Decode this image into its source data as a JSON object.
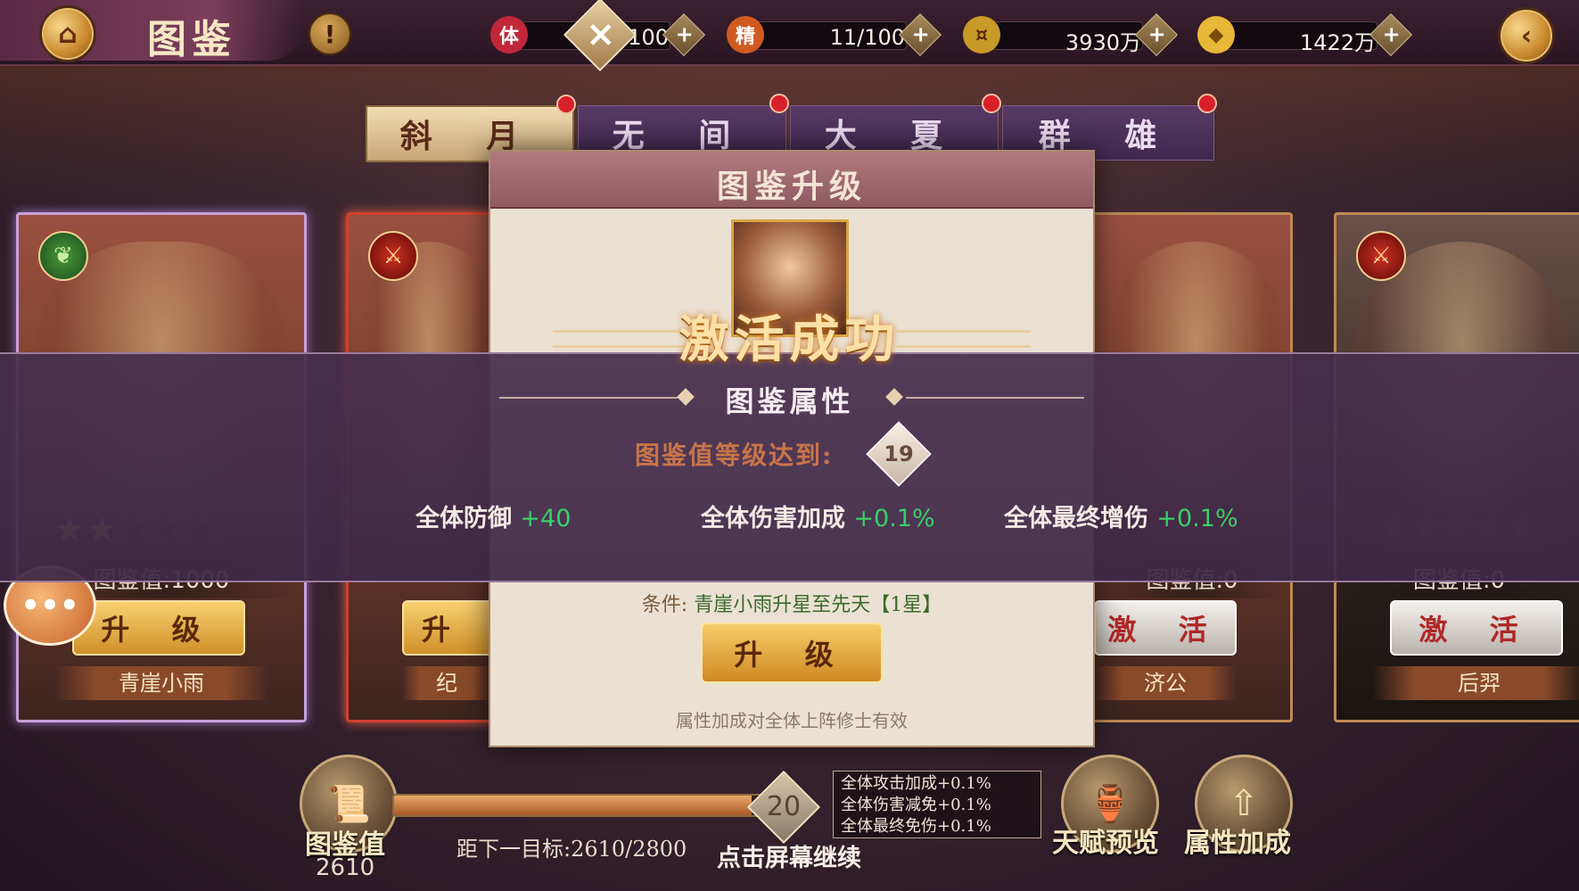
{
  "header": {
    "title": "图鉴",
    "resources": [
      {
        "icon": "stamina-icon",
        "glyph": "体",
        "value": "275/100",
        "color": "#c0283a"
      },
      {
        "icon": "spirit-icon",
        "glyph": "精",
        "value": "11/100",
        "color": "#d05a20"
      },
      {
        "icon": "coin-icon",
        "glyph": "¤",
        "value": "3930万",
        "color": "#c89a2a"
      },
      {
        "icon": "gold-ingot-icon",
        "glyph": "◆",
        "value": "1422万",
        "color": "#e8b838"
      }
    ]
  },
  "tabs": [
    {
      "label": "斜 月",
      "active": true
    },
    {
      "label": "无 间",
      "active": false
    },
    {
      "label": "大 夏",
      "active": false
    },
    {
      "label": "群 雄",
      "active": false
    }
  ],
  "cards": [
    {
      "name": "青崖小雨",
      "value_label": "图鉴值:1000",
      "button": "升 级",
      "stars_on": 2,
      "stars_total": 5
    },
    {
      "name": "纪",
      "button": "升"
    },
    {
      "name": "济公",
      "value_label": "图鉴值:0",
      "button": "激 活"
    },
    {
      "name": "后羿",
      "value_label": "图鉴值:0",
      "button": "激 活",
      "stars_on": 0,
      "stars_total": 5
    }
  ],
  "dialog": {
    "title": "图鉴升级",
    "condition_label": "条件:",
    "condition_text": "青崖小雨升星至先天【1星】",
    "upgrade_button": "升 级",
    "note": "属性加成对全体上阵修士有效"
  },
  "activation": {
    "banner": "激活成功",
    "section_title": "图鉴属性",
    "level_label": "图鉴值等级达到:",
    "level": "19",
    "attributes": [
      {
        "label": "全体防御",
        "bonus": "+40"
      },
      {
        "label": "全体伤害加成",
        "bonus": "+0.1%"
      },
      {
        "label": "全体最终增伤",
        "bonus": "+0.1%"
      }
    ]
  },
  "footer": {
    "collection_label": "图鉴值",
    "collection_value": "2610",
    "target_text": "距下一目标:2610/2800",
    "progress_fraction": 0.932,
    "next_level": "20",
    "next_rewards": [
      "全体攻击加成+0.1%",
      "全体伤害减免+0.1%",
      "全体最终免伤+0.1%"
    ],
    "continue_text": "点击屏幕继续",
    "talent_preview": "天赋预览",
    "attribute_bonus": "属性加成"
  }
}
